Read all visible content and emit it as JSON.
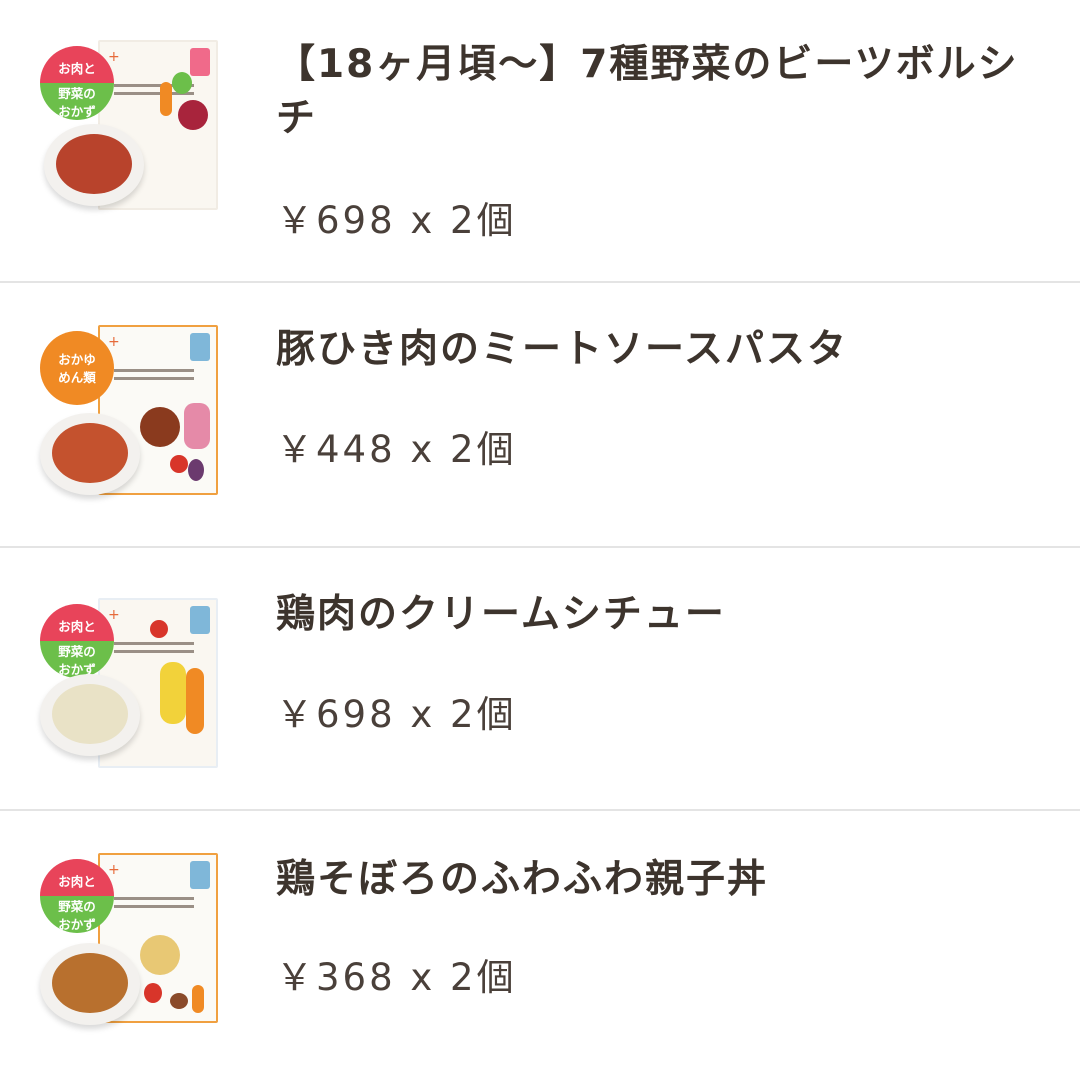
{
  "items": [
    {
      "title": "【18ヶ月頃〜】7種野菜のビーツボルシチ",
      "price": "￥698 x 2個",
      "badge": [
        "お肉と",
        "野菜の",
        "おかず"
      ],
      "food_color": "#b8432c"
    },
    {
      "title": "豚ひき肉のミートソースパスタ",
      "price": "￥448 x 2個",
      "badge": [
        "おかゆ",
        "めん類"
      ],
      "food_color": "#c4522e"
    },
    {
      "title": "鶏肉のクリームシチュー",
      "price": "￥698 x 2個",
      "badge": [
        "お肉と",
        "野菜の",
        "おかず"
      ],
      "food_color": "#e9e2c6"
    },
    {
      "title": "鶏そぼろのふわふわ親子丼",
      "price": "￥368 x 2個",
      "badge": [
        "お肉と",
        "野菜の",
        "おかず"
      ],
      "food_color": "#b8702e"
    }
  ]
}
